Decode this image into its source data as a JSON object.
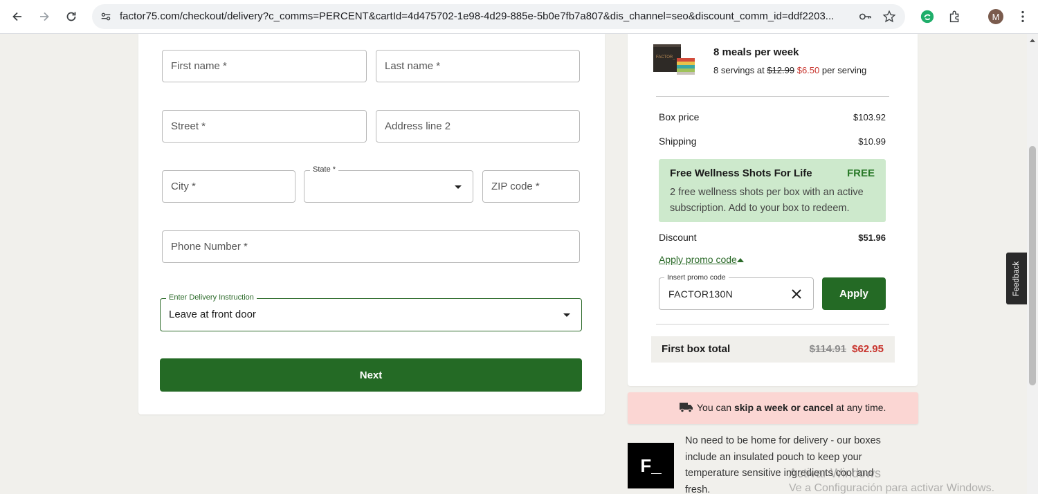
{
  "browser": {
    "url": "factor75.com/checkout/delivery?c_comms=PERCENT&cartId=4d475702-1e98-4d29-885e-5b0e7fb7a807&dis_channel=seo&discount_comm_id=ddf2203...",
    "avatar_letter": "M"
  },
  "form": {
    "first_name_ph": "First name *",
    "last_name_ph": "Last name *",
    "street_ph": "Street *",
    "address2_ph": "Address line 2",
    "city_ph": "City *",
    "state_label": "State *",
    "zip_ph": "ZIP code *",
    "phone_ph": "Phone Number *",
    "delivery_label": "Enter Delivery Instruction",
    "delivery_value": "Leave at front door",
    "next_label": "Next"
  },
  "summary": {
    "meals_title": "8 meals per week",
    "serving_prefix": "8 servings at",
    "serving_old": "$12.99",
    "serving_new": "$6.50",
    "serving_suffix": "per serving",
    "box_price_label": "Box price",
    "box_price_value": "$103.92",
    "shipping_label": "Shipping",
    "shipping_value": "$10.99",
    "promo_title": "Free Wellness Shots For Life",
    "promo_free": "FREE",
    "promo_desc": "2 free wellness shots per box with an active subscription. Add to your box to redeem.",
    "discount_label": "Discount",
    "discount_value": "$51.96",
    "apply_promo_link": "Apply promo code",
    "promo_input_label": "Insert promo code",
    "promo_input_value": "FACTOR130N",
    "apply_label": "Apply",
    "total_label": "First box total",
    "total_old": "$114.91",
    "total_new": "$62.95"
  },
  "banner": {
    "prefix": "You can",
    "bold": "skip a week or cancel",
    "suffix": "at any time."
  },
  "logo_text": "F_",
  "delivery_note": "No need to be home for delivery - our boxes include an insulated pouch to keep your temperature sensitive ingredients cool and fresh.",
  "feedback_label": "Feedback",
  "watermark": {
    "line1": "Activar Windows",
    "line2": "Ve a Configuración para activar Windows."
  },
  "colors": {
    "brand_green": "#246a25",
    "promo_green_bg": "#cde9cc",
    "discount_red": "#c8342d",
    "banner_pink": "#fbd6d3"
  }
}
